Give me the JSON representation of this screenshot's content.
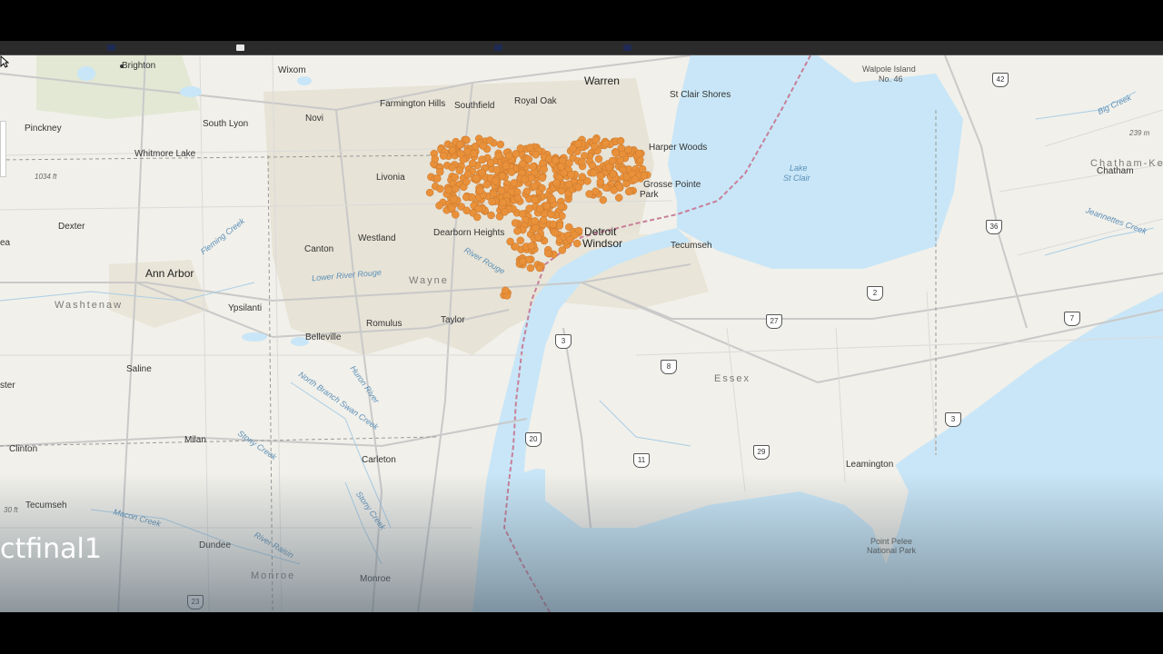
{
  "layer": {
    "title": "ctfinal1"
  },
  "colors": {
    "points": "#e8913a",
    "water": "#c8e6f7",
    "land": "#f1f0ea",
    "urban": "#e4e0d3"
  },
  "places": [
    {
      "id": "brighton",
      "name": "Brighton"
    },
    {
      "id": "wixom",
      "name": "Wixom"
    },
    {
      "id": "warren",
      "name": "Warren"
    },
    {
      "id": "farmington-hills",
      "name": "Farmington Hills"
    },
    {
      "id": "southfield",
      "name": "Southfield"
    },
    {
      "id": "royal-oak",
      "name": "Royal Oak"
    },
    {
      "id": "st-clair-shores",
      "name": "St Clair Shores"
    },
    {
      "id": "pinckney",
      "name": "Pinckney"
    },
    {
      "id": "south-lyon",
      "name": "South Lyon"
    },
    {
      "id": "novi",
      "name": "Novi"
    },
    {
      "id": "harper-woods",
      "name": "Harper Woods"
    },
    {
      "id": "whitmore-lake",
      "name": "Whitmore Lake"
    },
    {
      "id": "livonia",
      "name": "Livonia"
    },
    {
      "id": "grosse-pointe",
      "name": "Grosse Pointe"
    },
    {
      "id": "park",
      "name": "Park"
    },
    {
      "id": "dexter",
      "name": "Dexter"
    },
    {
      "id": "canton",
      "name": "Canton"
    },
    {
      "id": "westland",
      "name": "Westland"
    },
    {
      "id": "dearborn-heights",
      "name": "Dearborn Heights"
    },
    {
      "id": "detroit",
      "name": "Detroit"
    },
    {
      "id": "windsor",
      "name": "Windsor"
    },
    {
      "id": "tecumseh-on",
      "name": "Tecumseh"
    },
    {
      "id": "ann-arbor",
      "name": "Ann Arbor"
    },
    {
      "id": "ypsilanti",
      "name": "Ypsilanti"
    },
    {
      "id": "romulus",
      "name": "Romulus"
    },
    {
      "id": "taylor",
      "name": "Taylor"
    },
    {
      "id": "belleville",
      "name": "Belleville"
    },
    {
      "id": "saline",
      "name": "Saline"
    },
    {
      "id": "milan",
      "name": "Milan"
    },
    {
      "id": "carleton",
      "name": "Carleton"
    },
    {
      "id": "clinton",
      "name": "Clinton"
    },
    {
      "id": "tecumseh-mi",
      "name": "Tecumseh"
    },
    {
      "id": "dundee",
      "name": "Dundee"
    },
    {
      "id": "monroe-city",
      "name": "Monroe"
    },
    {
      "id": "leamington",
      "name": "Leamington"
    },
    {
      "id": "chatham",
      "name": "Chatham"
    },
    {
      "id": "chatham-kent",
      "name": "Chatham-Ker"
    },
    {
      "id": "walpole-island",
      "name": "Walpole Island"
    },
    {
      "id": "walpole-no",
      "name": "No. 46"
    },
    {
      "id": "point-pelee",
      "name": "Point Pelee"
    },
    {
      "id": "national-park",
      "name": "National Park"
    },
    {
      "id": "edge-ea",
      "name": "ea"
    },
    {
      "id": "edge-ster",
      "name": "ster"
    }
  ],
  "counties": [
    {
      "id": "washtenaw",
      "name": "Washtenaw"
    },
    {
      "id": "wayne",
      "name": "Wayne"
    },
    {
      "id": "monroe",
      "name": "Monroe"
    },
    {
      "id": "essex",
      "name": "Essex"
    }
  ],
  "water_labels": [
    {
      "id": "lake-st-clair-1",
      "name": "Lake"
    },
    {
      "id": "lake-st-clair-2",
      "name": "St Clair"
    },
    {
      "id": "fleming-creek",
      "name": "Fleming Creek"
    },
    {
      "id": "lower-river-rouge",
      "name": "Lower River Rouge"
    },
    {
      "id": "river-rouge",
      "name": "River Rouge"
    },
    {
      "id": "huron-river",
      "name": "Huron River"
    },
    {
      "id": "north-branch-swan-creek",
      "name": "North Branch Swan Creek"
    },
    {
      "id": "stony-creek-1",
      "name": "Stony Creek"
    },
    {
      "id": "stony-creek-2",
      "name": "Stony Creek"
    },
    {
      "id": "macon-creek",
      "name": "Macon Creek"
    },
    {
      "id": "river-raisin",
      "name": "River Raisin"
    },
    {
      "id": "big-creek",
      "name": "Big Creek"
    },
    {
      "id": "jeannettes-creek",
      "name": "Jeannettes Creek"
    }
  ],
  "elevations": [
    {
      "id": "elev-1034",
      "text": "1034 ft"
    },
    {
      "id": "elev-239",
      "text": "239 m"
    },
    {
      "id": "elev-30",
      "text": "30 ft"
    }
  ],
  "route_shields": [
    {
      "id": "r42",
      "text": "42"
    },
    {
      "id": "r36",
      "text": "36"
    },
    {
      "id": "r2",
      "text": "2"
    },
    {
      "id": "r27",
      "text": "27"
    },
    {
      "id": "r7",
      "text": "7"
    },
    {
      "id": "r3a",
      "text": "3"
    },
    {
      "id": "r8",
      "text": "8"
    },
    {
      "id": "r3b",
      "text": "3"
    },
    {
      "id": "r20",
      "text": "20"
    },
    {
      "id": "r11",
      "text": "11"
    },
    {
      "id": "r29",
      "text": "29"
    },
    {
      "id": "r23",
      "text": "23"
    }
  ]
}
